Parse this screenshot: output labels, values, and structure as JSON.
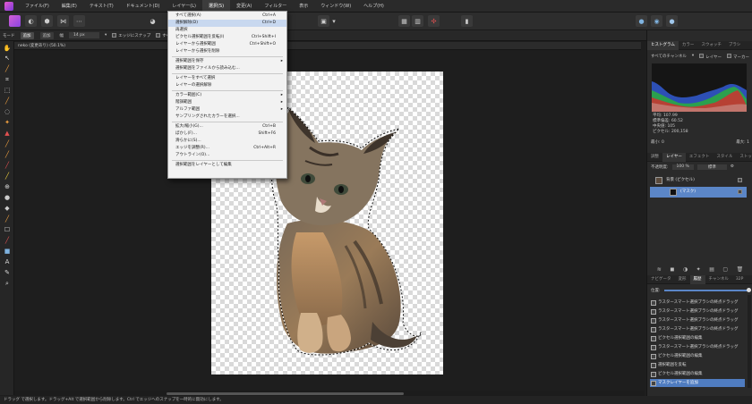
{
  "menubar": {
    "items": [
      "ファイル(F)",
      "編集(E)",
      "テキスト(T)",
      "ドキュメント(D)",
      "レイヤー(L)",
      "選択(S)",
      "変更(A)",
      "フィルター",
      "表示",
      "ウィンドウ(W)",
      "ヘルプ(H)"
    ],
    "active_index": 5
  },
  "context_toolbar": {
    "mode_label": "モード",
    "add_label": "追加",
    "mode_value": "追加",
    "width_label": "幅",
    "width_value": "14 px",
    "snap_label": "エッジにスナップ",
    "all_layers_label": "すべてのレイヤー"
  },
  "document_tab": {
    "title": "neko (変更あり) (50.1%)"
  },
  "status_bar": {
    "text": "ドラッグ で選択します。ドラッグ+Alt で選択範囲から削除します。Ctrl でエッジへのスナップを一時的に無効にします。"
  },
  "select_menu": {
    "items": [
      {
        "label": "すべて選択(A)",
        "shortcut": "Ctrl+A"
      },
      {
        "label": "選択解除(D)",
        "shortcut": "Ctrl+D",
        "highlighted": true
      },
      {
        "label": "再選択",
        "shortcut": ""
      },
      {
        "label": "ピクセル選択範囲を反転(I)",
        "shortcut": "Ctrl+Shift+I"
      },
      {
        "label": "レイヤーから選択範囲",
        "shortcut": "Ctrl+Shift+O"
      },
      {
        "label": "レイヤーから選択を削除",
        "shortcut": ""
      },
      {
        "sep": true
      },
      {
        "label": "選択範囲を保存",
        "shortcut": "",
        "submenu": true
      },
      {
        "label": "選択範囲をファイルから読み込む...",
        "shortcut": ""
      },
      {
        "sep": true
      },
      {
        "label": "レイヤーをすべて選択",
        "shortcut": ""
      },
      {
        "label": "レイヤーの選択解除",
        "shortcut": ""
      },
      {
        "sep": true
      },
      {
        "label": "カラー範囲(C)",
        "shortcut": "",
        "submenu": true
      },
      {
        "label": "階調範囲",
        "shortcut": "",
        "submenu": true
      },
      {
        "label": "アルファ範囲",
        "shortcut": "",
        "submenu": true
      },
      {
        "label": "サンプリングされたカラーを選択...",
        "shortcut": ""
      },
      {
        "sep": true
      },
      {
        "label": "拡大/縮小(G)...",
        "shortcut": "Ctrl+B"
      },
      {
        "label": "ぼかし(F)...",
        "shortcut": "Shift+F6"
      },
      {
        "label": "滑らかに(S)...",
        "shortcut": ""
      },
      {
        "label": "エッジを調整(R)...",
        "shortcut": "Ctrl+Alt+R"
      },
      {
        "label": "アウトライン(O)...",
        "shortcut": ""
      },
      {
        "sep": true
      },
      {
        "label": "選択範囲をレイヤーとして編集",
        "shortcut": ""
      }
    ]
  },
  "panel_top": {
    "tabs": [
      "ヒストグラム",
      "カラー",
      "スウォッチ",
      "ブラシ"
    ],
    "channel_label": "すべてのチャンネル",
    "layer_label": "レイヤー",
    "marker_label": "マーカー",
    "stats": [
      "平均: 107.99",
      "標準偏差: 60.52",
      "中央値: 105",
      "ピクセル: 200,158"
    ],
    "min_label": "最小: 0",
    "max_label": "最大: 1"
  },
  "layers_panel": {
    "tabs": [
      "調整",
      "レイヤー",
      "エフェクト",
      "スタイル",
      "ストック"
    ],
    "opacity_label": "不透明度:",
    "opacity_value": "100 %",
    "blend_value": "標準",
    "layers": [
      {
        "name": "背景 (ピクセル)",
        "selected": false
      },
      {
        "name": "(マスク)",
        "selected": true
      }
    ]
  },
  "history_panel": {
    "tabs": [
      "ナビゲータ",
      "変形",
      "履歴",
      "チャンネル",
      "32P"
    ],
    "slider_label": "位置:",
    "items": [
      "ラスタースマート選択ブラシの終点ドラッグ",
      "ラスタースマート選択ブラシの終点ドラッグ",
      "ラスタースマート選択ブラシの終点ドラッグ",
      "ラスタースマート選択ブラシの終点ドラッグ",
      "ピクセル選択範囲の編集",
      "ラスタースマート選択ブラシの終点ドラッグ",
      "ピクセル選択範囲の編集",
      "選択範囲を反転",
      "ピクセル選択範囲の編集",
      "マスクレイヤーを追加"
    ]
  },
  "colors": {
    "accent": "#5b86c7",
    "menu_bg": "#f2f2f2",
    "app_bg": "#1e1e1e"
  }
}
